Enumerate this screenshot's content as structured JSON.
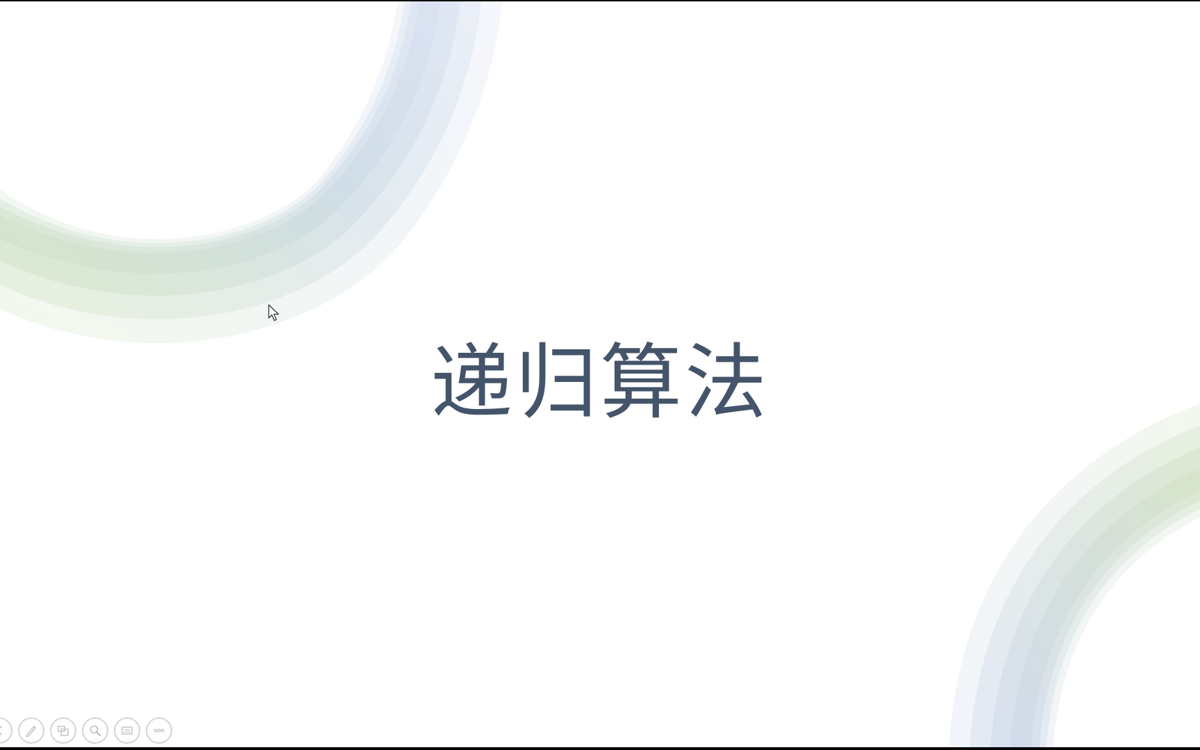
{
  "slide": {
    "title": "递归算法",
    "title_color": "#44546a",
    "accent_green": "#c9dcb5",
    "accent_blue": "#c3d2e8"
  },
  "toolbar": {
    "buttons": [
      {
        "icon": "previous-icon"
      },
      {
        "icon": "pen-icon"
      },
      {
        "icon": "see-all-slides-icon"
      },
      {
        "icon": "zoom-icon"
      },
      {
        "icon": "subtitles-icon"
      },
      {
        "icon": "more-options-icon"
      }
    ]
  }
}
